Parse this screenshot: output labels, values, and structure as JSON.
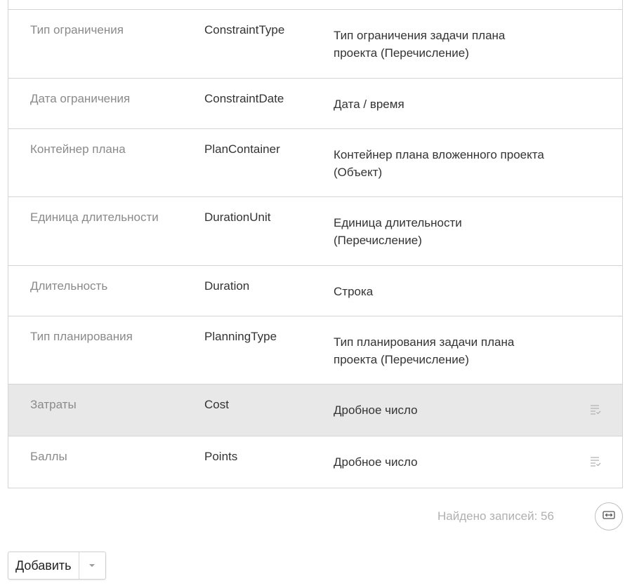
{
  "rows": [
    {
      "name": "Тип ограничения",
      "code": "ConstraintType",
      "type": "Тип ограничения задачи плана проекта (Перечисление)"
    },
    {
      "name": "Дата ограничения",
      "code": "ConstraintDate",
      "type": "Дата / время"
    },
    {
      "name": "Контейнер плана",
      "code": "PlanContainer",
      "type": "Контейнер плана вложенного проекта (Объект)"
    },
    {
      "name": "Единица длительности",
      "code": "DurationUnit",
      "type": "Единица длительности (Перечисление)"
    },
    {
      "name": "Длительность",
      "code": "Duration",
      "type": "Строка"
    },
    {
      "name": "Тип планирования",
      "code": "PlanningType",
      "type": "Тип планирования задачи плана проекта (Перечисление)"
    },
    {
      "name": "Затраты",
      "code": "Cost",
      "type": "Дробное число"
    },
    {
      "name": "Баллы",
      "code": "Points",
      "type": "Дробное число"
    }
  ],
  "footer": {
    "records_found": "Найдено записей: 56"
  },
  "actions": {
    "add_label": "Добавить"
  },
  "icons": {
    "row_menu": "list-check-icon",
    "expand": "expand-horizontal-icon",
    "dropdown": "caret-down-icon"
  },
  "colors": {
    "highlight_row": "#e8e8e8",
    "border": "#d4d4d4",
    "muted_text": "#8a8a8a"
  }
}
